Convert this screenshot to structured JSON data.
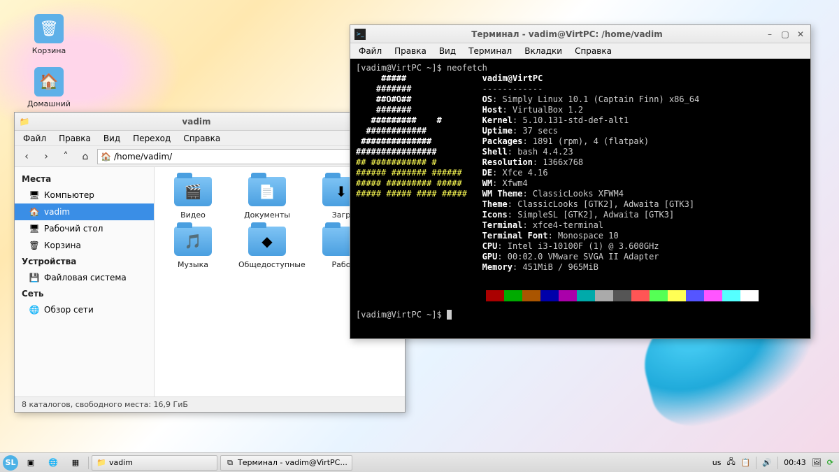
{
  "desktop": {
    "icons": [
      {
        "name": "trash",
        "label": "Корзина",
        "emoji": "🗑",
        "color": "#5eb0e8"
      },
      {
        "name": "home",
        "label": "Домашний",
        "emoji": "🏠",
        "color": "#5eb0e8"
      }
    ]
  },
  "fm": {
    "title": "vadim",
    "menu": [
      "Файл",
      "Правка",
      "Вид",
      "Переход",
      "Справка"
    ],
    "path": "/home/vadim/",
    "sidebar": {
      "groups": [
        {
          "header": "Места",
          "items": [
            {
              "name": "computer",
              "label": "Компьютер",
              "icon": "🖥",
              "sel": false
            },
            {
              "name": "vadim",
              "label": "vadim",
              "icon": "🏠",
              "sel": true
            },
            {
              "name": "desktop",
              "label": "Рабочий стол",
              "icon": "🖥",
              "sel": false
            },
            {
              "name": "trash",
              "label": "Корзина",
              "icon": "🗑",
              "sel": false
            }
          ]
        },
        {
          "header": "Устройства",
          "items": [
            {
              "name": "filesystem",
              "label": "Файловая система",
              "icon": "💾",
              "sel": false
            }
          ]
        },
        {
          "header": "Сеть",
          "items": [
            {
              "name": "network",
              "label": "Обзор сети",
              "icon": "🌐",
              "sel": false
            }
          ]
        }
      ]
    },
    "folders": [
      {
        "name": "videos",
        "label": "Видео",
        "overlay": "🎬"
      },
      {
        "name": "documents",
        "label": "Документы",
        "overlay": "📄"
      },
      {
        "name": "downloads",
        "label": "Загр",
        "overlay": "⬇"
      },
      {
        "name": "music",
        "label": "Музыка",
        "overlay": "🎵"
      },
      {
        "name": "public",
        "label": "Общедоступные",
        "overlay": "◆"
      },
      {
        "name": "desktop",
        "label": "Рабо",
        "overlay": ""
      }
    ],
    "status": "8 каталогов, свободного места: 16,9 ГиБ"
  },
  "term": {
    "title": "Терминал - vadim@VirtPC: /home/vadim",
    "menu": [
      "Файл",
      "Правка",
      "Вид",
      "Терминал",
      "Вкладки",
      "Справка"
    ],
    "prompt": "[vadim@VirtPC ~]$ ",
    "cmd": "neofetch",
    "ascii": [
      "     #####",
      "    #######",
      "    ##O#O##",
      "    #######",
      "   #########    #",
      "  ############ ",
      " ############## ",
      "################",
      "## ########### #",
      "###### ####### ######",
      "##### ######### #####",
      "##### ##### #### #####"
    ],
    "header": "vadim@VirtPC",
    "dash": "------------",
    "info": [
      {
        "k": "OS",
        "v": "Simply Linux 10.1 (Captain Finn) x86_64"
      },
      {
        "k": "Host",
        "v": "VirtualBox 1.2"
      },
      {
        "k": "Kernel",
        "v": "5.10.131-std-def-alt1"
      },
      {
        "k": "Uptime",
        "v": "37 secs"
      },
      {
        "k": "Packages",
        "v": "1891 (rpm), 4 (flatpak)"
      },
      {
        "k": "Shell",
        "v": "bash 4.4.23"
      },
      {
        "k": "Resolution",
        "v": "1366x768"
      },
      {
        "k": "DE",
        "v": "Xfce 4.16"
      },
      {
        "k": "WM",
        "v": "Xfwm4"
      },
      {
        "k": "WM Theme",
        "v": "ClassicLooks XFWM4"
      },
      {
        "k": "Theme",
        "v": "ClassicLooks [GTK2], Adwaita [GTK3]"
      },
      {
        "k": "Icons",
        "v": "SimpleSL [GTK2], Adwaita [GTK3]"
      },
      {
        "k": "Terminal",
        "v": "xfce4-terminal"
      },
      {
        "k": "Terminal Font",
        "v": "Monospace 10"
      },
      {
        "k": "CPU",
        "v": "Intel i3-10100F (1) @ 3.600GHz"
      },
      {
        "k": "GPU",
        "v": "00:02.0 VMware SVGA II Adapter"
      },
      {
        "k": "Memory",
        "v": "451MiB / 965MiB"
      }
    ],
    "palette": [
      "#000",
      "#a00",
      "#0a0",
      "#a50",
      "#00a",
      "#a0a",
      "#0aa",
      "#aaa",
      "#555",
      "#f55",
      "#5f5",
      "#ff5",
      "#55f",
      "#f5f",
      "#5ff",
      "#fff"
    ]
  },
  "taskbar": {
    "tasks": [
      {
        "name": "fm-task",
        "icon": "📁",
        "label": "vadim"
      },
      {
        "name": "term-task",
        "icon": "⧉",
        "label": "Терминал - vadim@VirtPC..."
      }
    ],
    "tray": {
      "layout": "us",
      "clock": "00:43"
    }
  }
}
